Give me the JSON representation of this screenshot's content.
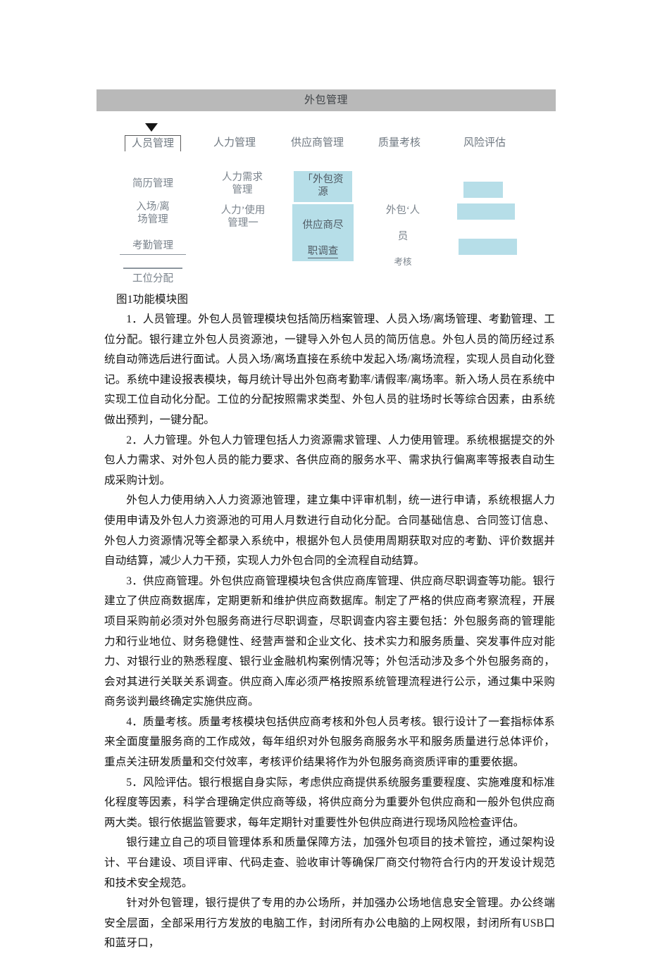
{
  "figure": {
    "title_bar_label": "外包管理",
    "title_bar_color": "#b9b9b9",
    "highlight_color": "#b6dee8",
    "columns": [
      {
        "header": "人员管理",
        "boxed": true,
        "nodes": [
          "简历管理",
          "入场/离\n场管理",
          "考勤管理",
          "工位分配"
        ]
      },
      {
        "header": "人力管理",
        "boxed": false,
        "nodes": [
          "人力需求\n管理",
          "人力’使用\n管理一"
        ]
      },
      {
        "header": "供应商管理",
        "boxed": false,
        "nodes": [
          "「外包资\n源",
          "供应商尽",
          "职调查"
        ]
      },
      {
        "header": "质量考核",
        "boxed": false,
        "nodes": [
          "外包‘人",
          "员",
          "考核"
        ]
      },
      {
        "header": "风险评估",
        "boxed": false,
        "nodes": [
          "",
          "",
          ""
        ]
      }
    ],
    "caption": "图1功能模块图"
  },
  "body": {
    "paragraphs": [
      "1．人员管理。外包人员管理模块包括简历档案管理、人员入场/离场管理、考勤管理、工位分配。银行建立外包人员资源池，一键导入外包人员的简历信息。外包人员的简历经过系统自动筛选后进行面试。人员入场/离场直接在系统中发起入场/离场流程，实现人员自动化登记。系统中建设报表模块，每月统计导出外包商考勤率/请假率/离场率。新入场人员在系统中实现工位自动化分配。工位的分配按照需求类型、外包人员的驻场时长等综合因素，由系统做出预判，一键分配。",
      "2．人力管理。外包人力管理包括人力资源需求管理、人力使用管理。系统根据提交的外包人力需求、对外包人员的能力要求、各供应商的服务水平、需求执行偏离率等报表自动生成采购计划。",
      "外包人力使用纳入人力资源池管理，建立集中评审机制，统一进行申请，系统根据人力使用申请及外包人力资源池的可用人月数进行自动化分配。合同基础信息、合同签订信息、外包人力资源情况等全都录入系统中，根据外包人员使用周期获取对应的考勤、评价数据并自动结算，减少人力干预，实现人力外包合同的全流程自动结算。",
      "3．供应商管理。外包供应商管理模块包含供应商库管理、供应商尽职调查等功能。银行建立了供应商数据库，定期更新和维护供应商数据库。制定了严格的供应商考察流程，开展项目采购前必须对外包服务商进行尽职调查，尽职调查内容主要包括：外包服务商的管理能力和行业地位、财务稳健性、经营声誉和企业文化、技术实力和服务质量、突发事件应对能力、对银行业的熟悉程度、银行业金融机构案例情况等；外包活动涉及多个外包服务商的，会对其进行关联关系调查。供应商入库必须严格按照系统管理流程进行公示，通过集中采购商务谈判最终确定实施供应商。",
      "4．质量考核。质量考核模块包括供应商考核和外包人员考核。银行设计了一套指标体系来全面度量服务商的工作成效，每年组织对外包服务商服务水平和服务质量进行总体评价，重点关注研发质量和交付效率，考核评价结果将作为外包服务商资质评审的重要依据。",
      "5．风险评估。银行根据自身实际，考虑供应商提供系统服务重要程度、实施难度和标准化程度等因素，科学合理确定供应商等级，将供应商分为重要外包供应商和一般外包供应商两大类。银行依据监管要求，每年定期针对重要性外包供应商进行现场风险检查评估。",
      "银行建立自己的项目管理体系和质量保障方法，加强外包项目的技术管控，通过架构设计、平台建设、项目评审、代码走查、验收审计等确保厂商交付物符合行内的开发设计规范和技术安全规范。",
      "针对外包管理，银行提供了专用的办公场所，并加强办公场地信息安全管理。办公终端安全层面，全部采用行方发放的电脑工作，封闭所有办公电脑的上网权限，封闭所有USB口和蓝牙口，"
    ]
  }
}
